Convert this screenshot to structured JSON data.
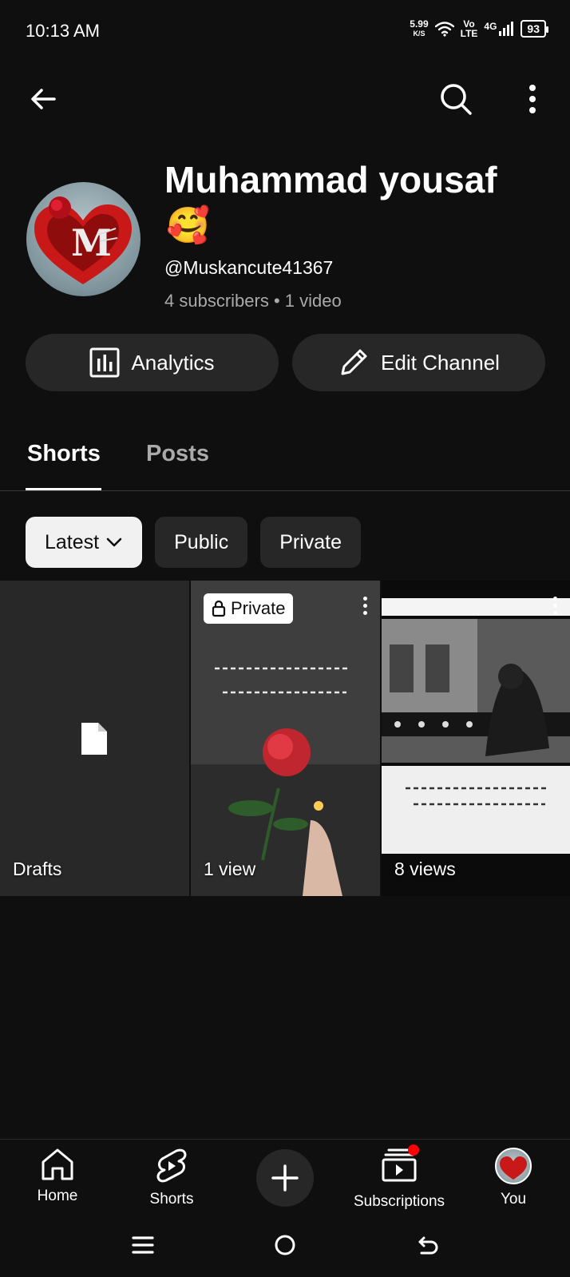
{
  "status_bar": {
    "time": "10:13 AM",
    "net_speed": "5.99",
    "net_speed_unit": "K/S",
    "volte_top": "Vo",
    "volte_bottom": "LTE",
    "network": "4G",
    "battery": "93"
  },
  "channel": {
    "name": "Muhammad yousaf",
    "emoji": "🥰",
    "handle": "@Muskancute41367",
    "meta": "4 subscribers • 1 video",
    "avatar_letter": "M"
  },
  "actions": {
    "analytics_label": "Analytics",
    "edit_label": "Edit Channel"
  },
  "tabs": [
    {
      "label": "Shorts",
      "active": true
    },
    {
      "label": "Posts",
      "active": false
    }
  ],
  "chips": {
    "latest": "Latest",
    "public": "Public",
    "private": "Private"
  },
  "grid": {
    "drafts_label": "Drafts",
    "item2": {
      "badge": "Private",
      "views": "1 view"
    },
    "item3": {
      "views": "8 views"
    }
  },
  "bottom_nav": {
    "home": "Home",
    "shorts": "Shorts",
    "subscriptions": "Subscriptions",
    "you": "You"
  },
  "colors": {
    "background": "#0f0f0f",
    "surface": "#272727",
    "secondary_text": "#aaaaaa",
    "notification": "#ff0000"
  }
}
